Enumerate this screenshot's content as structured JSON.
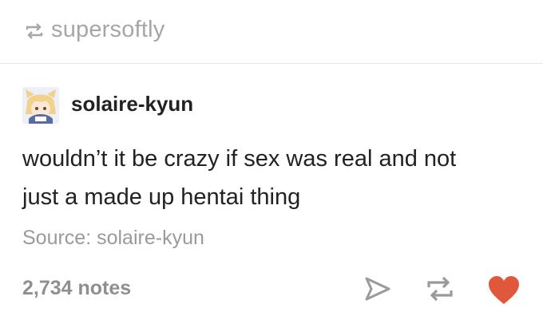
{
  "reblog": {
    "icon": "reblog-icon",
    "username": "supersoftly"
  },
  "post": {
    "author": "solaire-kyun",
    "avatar": "anime-avatar",
    "body_lines": [
      "wouldn’t it be crazy if sex was real and not",
      "just a made up hentai thing"
    ],
    "source": "Source: solaire-kyun"
  },
  "footer": {
    "notes": "2,734 notes",
    "actions": [
      "share-icon",
      "reblog-icon",
      "heart-icon"
    ]
  },
  "colors": {
    "heart": "#e0583c",
    "muted": "#a6a6a6",
    "text": "#222222"
  }
}
